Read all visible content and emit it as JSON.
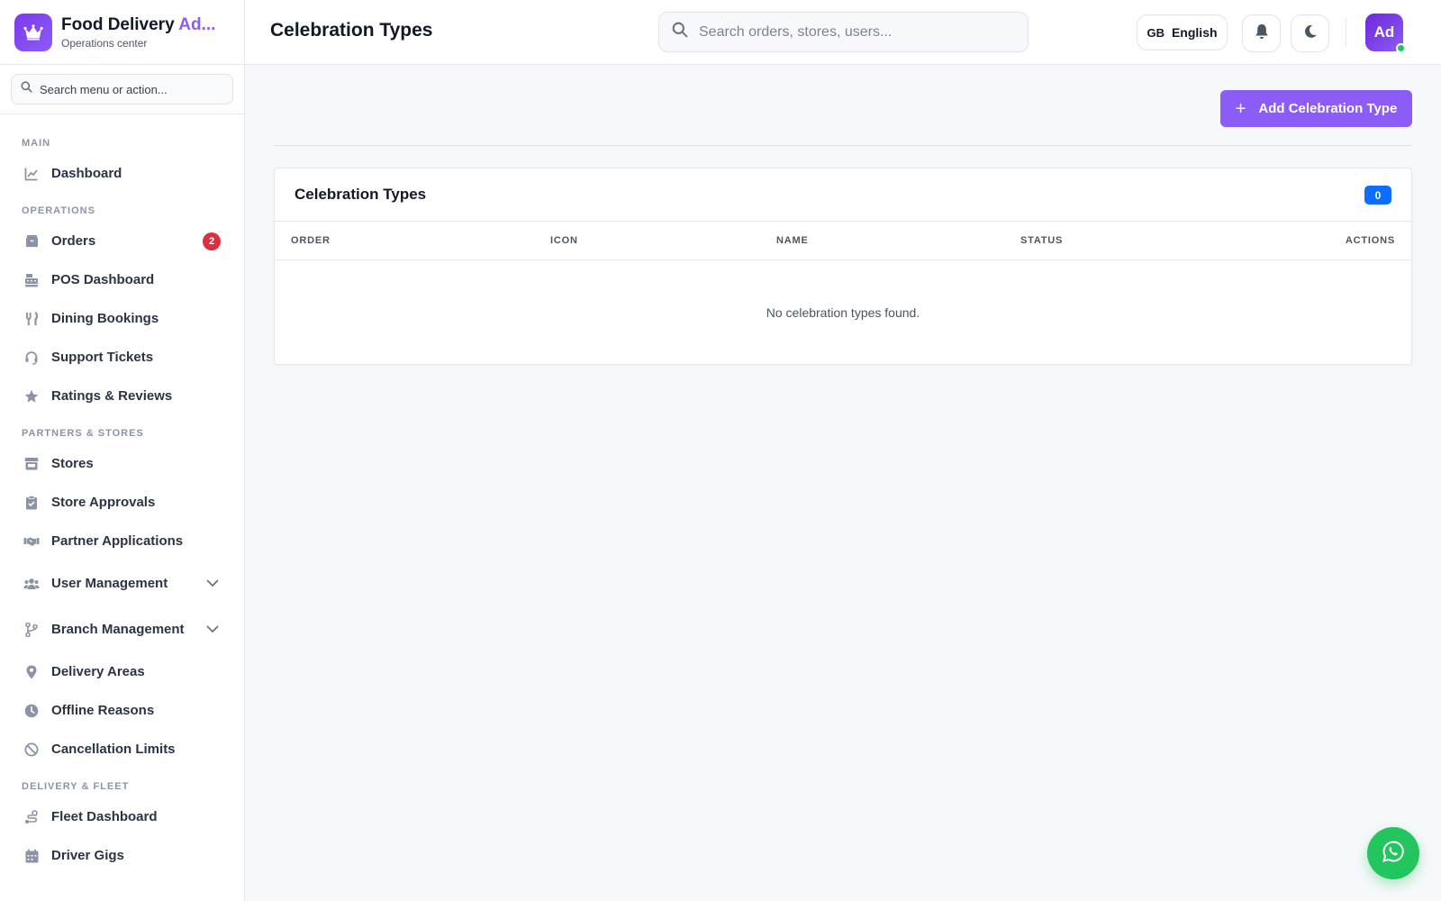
{
  "brand": {
    "title_main": "Food Delivery ",
    "title_accent": "Ad...",
    "subtitle": "Operations center",
    "icon": "crown-icon"
  },
  "sidebar_search": {
    "placeholder": "Search menu or action..."
  },
  "sidebar": {
    "sections": [
      {
        "label": "MAIN",
        "items": [
          {
            "label": "Dashboard",
            "icon": "chart-line-icon"
          }
        ]
      },
      {
        "label": "OPERATIONS",
        "items": [
          {
            "label": "Orders",
            "icon": "box-icon",
            "badge": "2"
          },
          {
            "label": "POS Dashboard",
            "icon": "cash-register-icon"
          },
          {
            "label": "Dining Bookings",
            "icon": "utensils-icon"
          },
          {
            "label": "Support Tickets",
            "icon": "headset-icon"
          },
          {
            "label": "Ratings & Reviews",
            "icon": "star-icon"
          }
        ]
      },
      {
        "label": "PARTNERS & STORES",
        "items": [
          {
            "label": "Stores",
            "icon": "store-icon"
          },
          {
            "label": "Store Approvals",
            "icon": "clipboard-check-icon"
          },
          {
            "label": "Partner Applications",
            "icon": "handshake-icon"
          },
          {
            "label": "User Management",
            "icon": "users-icon",
            "expandable": true
          },
          {
            "label": "Branch Management",
            "icon": "code-branch-icon",
            "expandable": true
          },
          {
            "label": "Delivery Areas",
            "icon": "map-pin-icon"
          },
          {
            "label": "Offline Reasons",
            "icon": "clock-icon"
          },
          {
            "label": "Cancellation Limits",
            "icon": "ban-icon"
          }
        ]
      },
      {
        "label": "DELIVERY & FLEET",
        "items": [
          {
            "label": "Fleet Dashboard",
            "icon": "route-icon"
          },
          {
            "label": "Driver Gigs",
            "icon": "calendar-icon"
          }
        ]
      }
    ]
  },
  "header": {
    "title": "Celebration Types",
    "search_placeholder": "Search orders, stores, users...",
    "language": {
      "flag": "GB",
      "label": "English"
    },
    "avatar_initials": "Ad"
  },
  "main": {
    "add_button": "Add Celebration Type",
    "card": {
      "title": "Celebration Types",
      "count": "0",
      "columns": [
        "ORDER",
        "ICON",
        "NAME",
        "STATUS",
        "ACTIONS"
      ],
      "empty_message": "No celebration types found."
    }
  },
  "colors": {
    "accent": "#8b5cf6",
    "badge_red": "#dc2f3f",
    "count_blue": "#0d6efd",
    "whatsapp_green": "#22c55e"
  }
}
